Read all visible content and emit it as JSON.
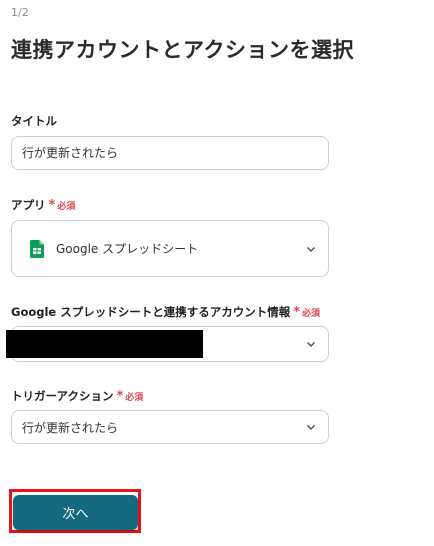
{
  "step_indicator": "1/2",
  "page_title": "連携アカウントとアクションを選択",
  "form": {
    "title_field": {
      "label": "タイトル",
      "value": "行が更新されたら"
    },
    "app_field": {
      "label": "アプリ",
      "required_mark": "*",
      "required_text": "必須",
      "value": "Google スプレッドシート",
      "icon": "google-sheets-icon"
    },
    "account_field": {
      "label": "Google スプレッドシートと連携するアカウント情報",
      "required_mark": "*",
      "required_text": "必須",
      "value": ""
    },
    "trigger_field": {
      "label": "トリガーアクション",
      "required_mark": "*",
      "required_text": "必須",
      "value": "行が更新されたら"
    }
  },
  "next_button": {
    "label": "次へ"
  },
  "colors": {
    "accent": "#15697e",
    "required": "#e0464c",
    "highlight_outline": "#e8141b",
    "sheets_green": "#0f9d58"
  }
}
